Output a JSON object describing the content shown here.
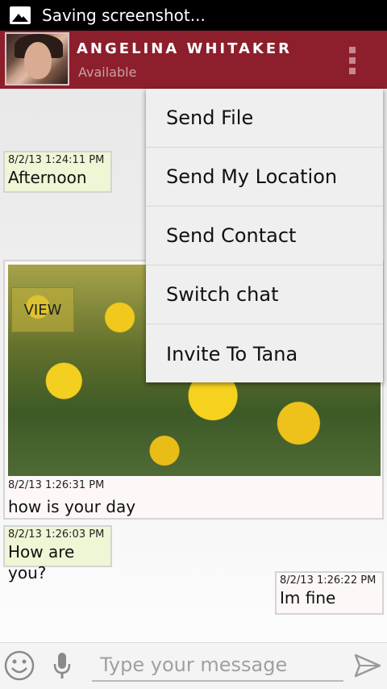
{
  "status_bar": {
    "text": "Saving screenshot..."
  },
  "header": {
    "name": "ANGELINA WHITAKER",
    "status": "Available"
  },
  "menu": {
    "items": [
      {
        "label": "Send File"
      },
      {
        "label": "Send My Location"
      },
      {
        "label": "Send Contact"
      },
      {
        "label": "Switch chat"
      },
      {
        "label": "Invite To Tana"
      }
    ]
  },
  "messages": [
    {
      "time": "8/2/13 1:24:11 PM",
      "text": "Afternoon"
    },
    {
      "time": "8/2/13 1:26:31 PM",
      "text": "how is your day",
      "view_label": "VIEW"
    },
    {
      "time": "8/2/13 1:26:03 PM",
      "text": "How are you?"
    },
    {
      "time": "8/2/13 1:26:22 PM",
      "text": "Im fine"
    }
  ],
  "input": {
    "placeholder": "Type your message"
  },
  "icons": {
    "status": "image-icon",
    "overflow": "overflow-menu-icon",
    "emoji": "smiley-icon",
    "mic": "microphone-icon",
    "send": "send-icon"
  },
  "colors": {
    "header": "#8c1f2b",
    "incoming_bubble": "#eef6d5",
    "outgoing_bubble": "#fdf7f7"
  }
}
